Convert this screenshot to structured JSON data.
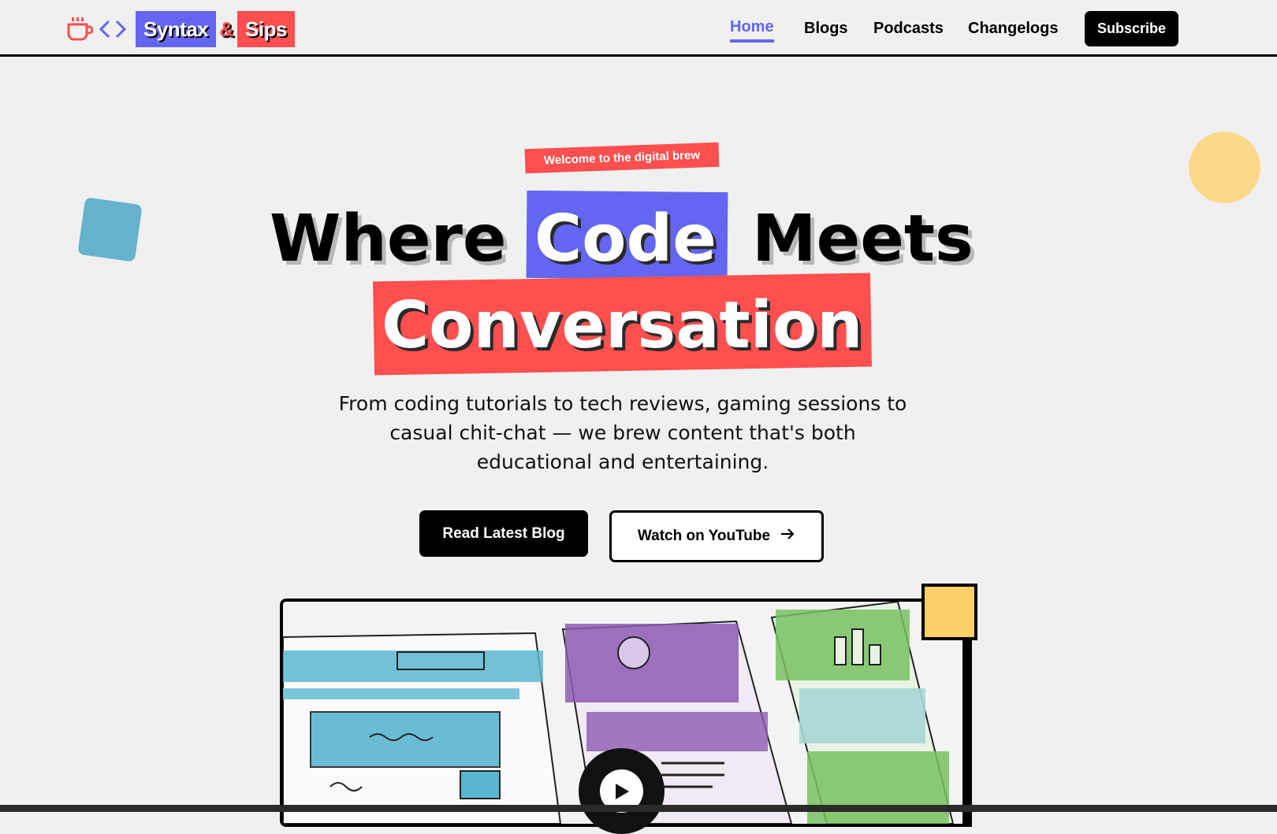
{
  "brand": {
    "word1": "Syntax",
    "amp": "&",
    "word2": "Sips"
  },
  "nav": {
    "items": [
      {
        "label": "Home",
        "active": true
      },
      {
        "label": "Blogs"
      },
      {
        "label": "Podcasts"
      },
      {
        "label": "Changelogs"
      }
    ],
    "subscribe": "Subscribe"
  },
  "hero": {
    "badge": "Welcome to the digital brew",
    "title_where": "Where",
    "title_code": "Code",
    "title_meets": "Meets",
    "title_conversation": "Conversation",
    "description": "From coding tutorials to tech reviews, gaming sessions to casual chit-chat — we brew content that's both educational and entertaining.",
    "primary_button": "Read Latest Blog",
    "secondary_button": "Watch on YouTube"
  },
  "colors": {
    "accent_purple": "#6366f1",
    "accent_red": "#ff4f4f",
    "accent_yellow": "#fcd066",
    "accent_blue": "#67b2cd",
    "background": "#f0f0f0"
  },
  "icons": [
    "coffee-cup-icon",
    "code-brackets-icon",
    "arrow-right-icon",
    "play-icon"
  ]
}
